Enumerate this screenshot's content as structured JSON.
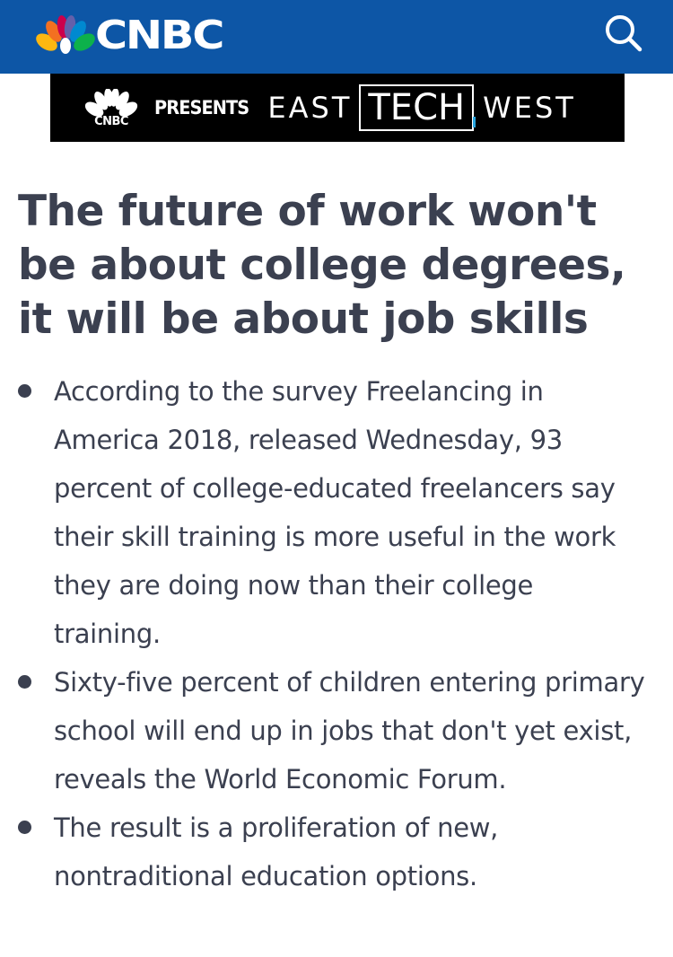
{
  "header": {
    "brand": "CNBC",
    "search_icon": "search-icon",
    "background_color": "#0d56a6"
  },
  "banner": {
    "logo_text": "CNBC",
    "presents": "PRESENTS",
    "east": "EAST",
    "tech": "TECH",
    "west": "WEST"
  },
  "article": {
    "headline": "The future of work won't be about college degrees, it will be about job skills",
    "bullets": [
      "According to the survey Freelancing in America 2018, released Wednesday, 93 percent of college-educated freelancers say their skill training is more useful in the work they are doing now than their college training.",
      "Sixty-five percent of children entering primary school will end up in jobs that don't yet exist, reveals the World Economic Forum.",
      "The result is a proliferation of new, nontraditional education options."
    ],
    "text_color": "#3b4050"
  }
}
